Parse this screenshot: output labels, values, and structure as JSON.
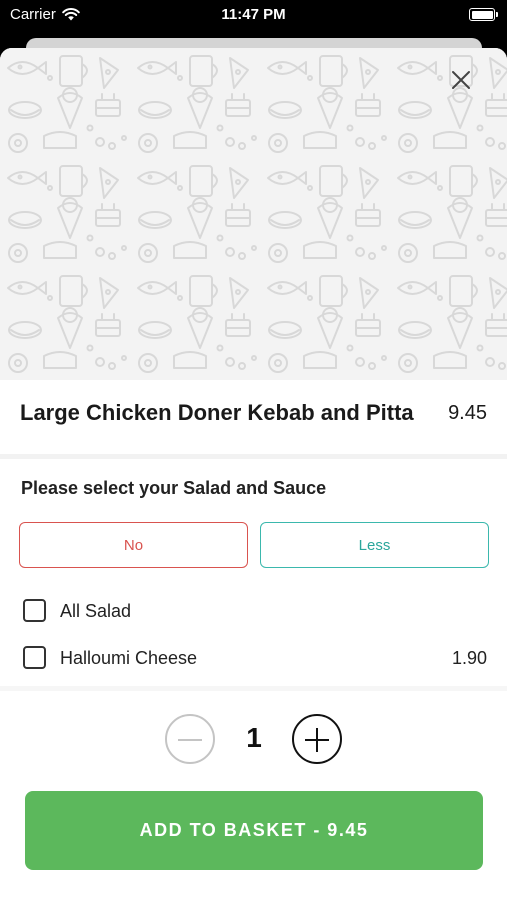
{
  "status_bar": {
    "carrier": "Carrier",
    "time": "11:47 PM"
  },
  "item": {
    "title": "Large Chicken Doner Kebab and Pitta",
    "price": "9.45"
  },
  "section": {
    "title": "Please select your Salad and Sauce",
    "options": [
      {
        "label": "No",
        "color": "#d9534f"
      },
      {
        "label": "Less",
        "color": "#2aa69b"
      }
    ]
  },
  "extras": [
    {
      "label": "All Salad",
      "price": "",
      "checked": false
    },
    {
      "label": "Halloumi Cheese",
      "price": "1.90",
      "checked": false
    }
  ],
  "quantity": {
    "value": "1"
  },
  "add_button": {
    "label": "ADD TO BASKET  -  9.45",
    "color": "#5cb85c"
  },
  "icons": [
    "wifi-icon",
    "battery-icon",
    "close-icon",
    "minus-icon",
    "plus-icon",
    "food-pattern-background"
  ]
}
